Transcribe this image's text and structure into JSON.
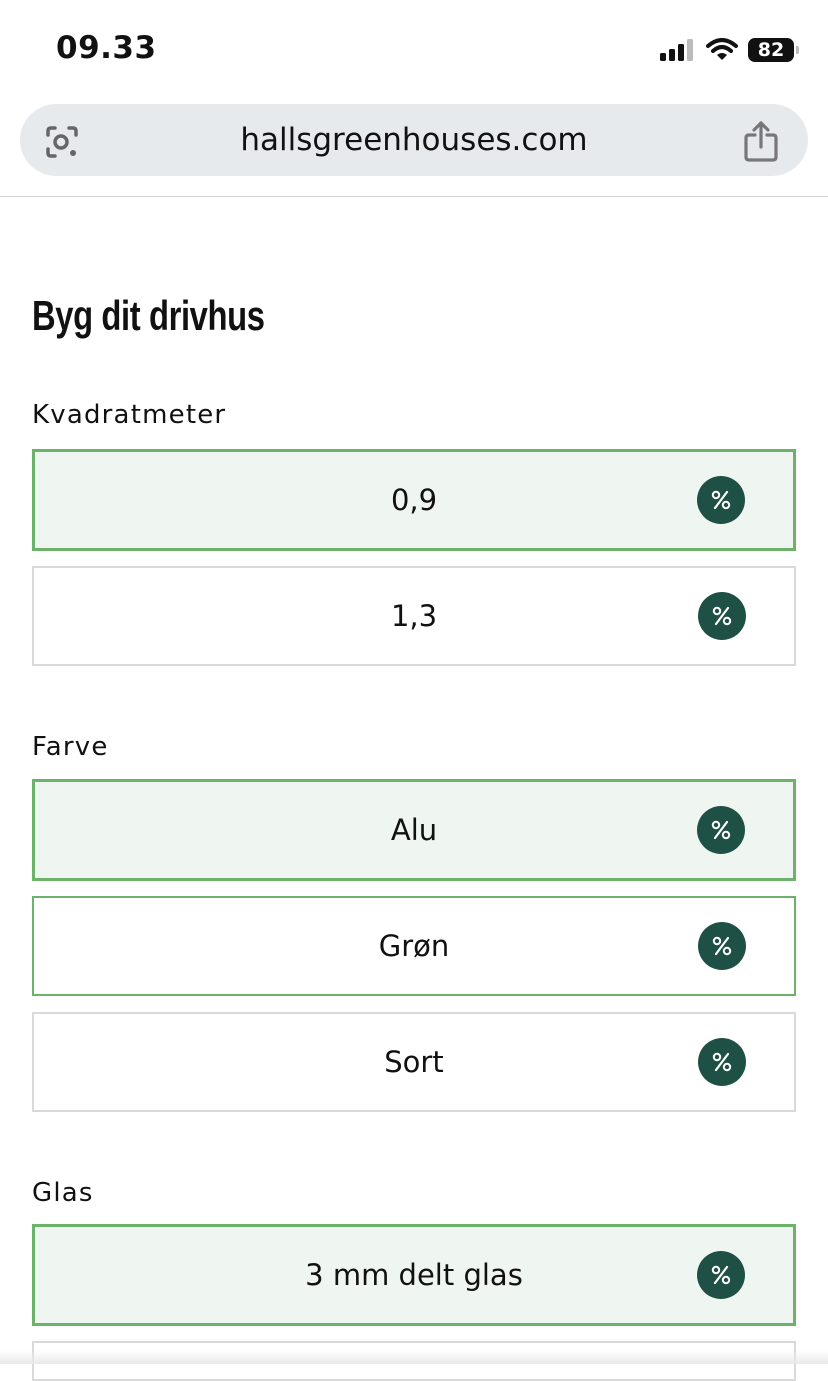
{
  "status": {
    "time": "09.33",
    "battery": "82"
  },
  "browser": {
    "url": "hallsgreenhouses.com"
  },
  "page": {
    "title": "Byg dit drivhus"
  },
  "groups": [
    {
      "label": "Kvadratmeter",
      "options": [
        {
          "label": "0,9",
          "selected": true
        },
        {
          "label": "1,3",
          "selected": false
        }
      ]
    },
    {
      "label": "Farve",
      "options": [
        {
          "label": "Alu",
          "selected": true
        },
        {
          "label": "Grøn",
          "selected": false
        },
        {
          "label": "Sort",
          "selected": false
        }
      ]
    },
    {
      "label": "Glas",
      "options": [
        {
          "label": "3 mm delt glas",
          "selected": true
        }
      ]
    }
  ],
  "colors": {
    "accent_green": "#6db26a",
    "selected_bg": "#eff6f1",
    "badge": "#1f5045"
  },
  "icons": {
    "badge": "percent-icon",
    "left_url": "visual-lookup-icon",
    "right_url": "share-icon"
  }
}
